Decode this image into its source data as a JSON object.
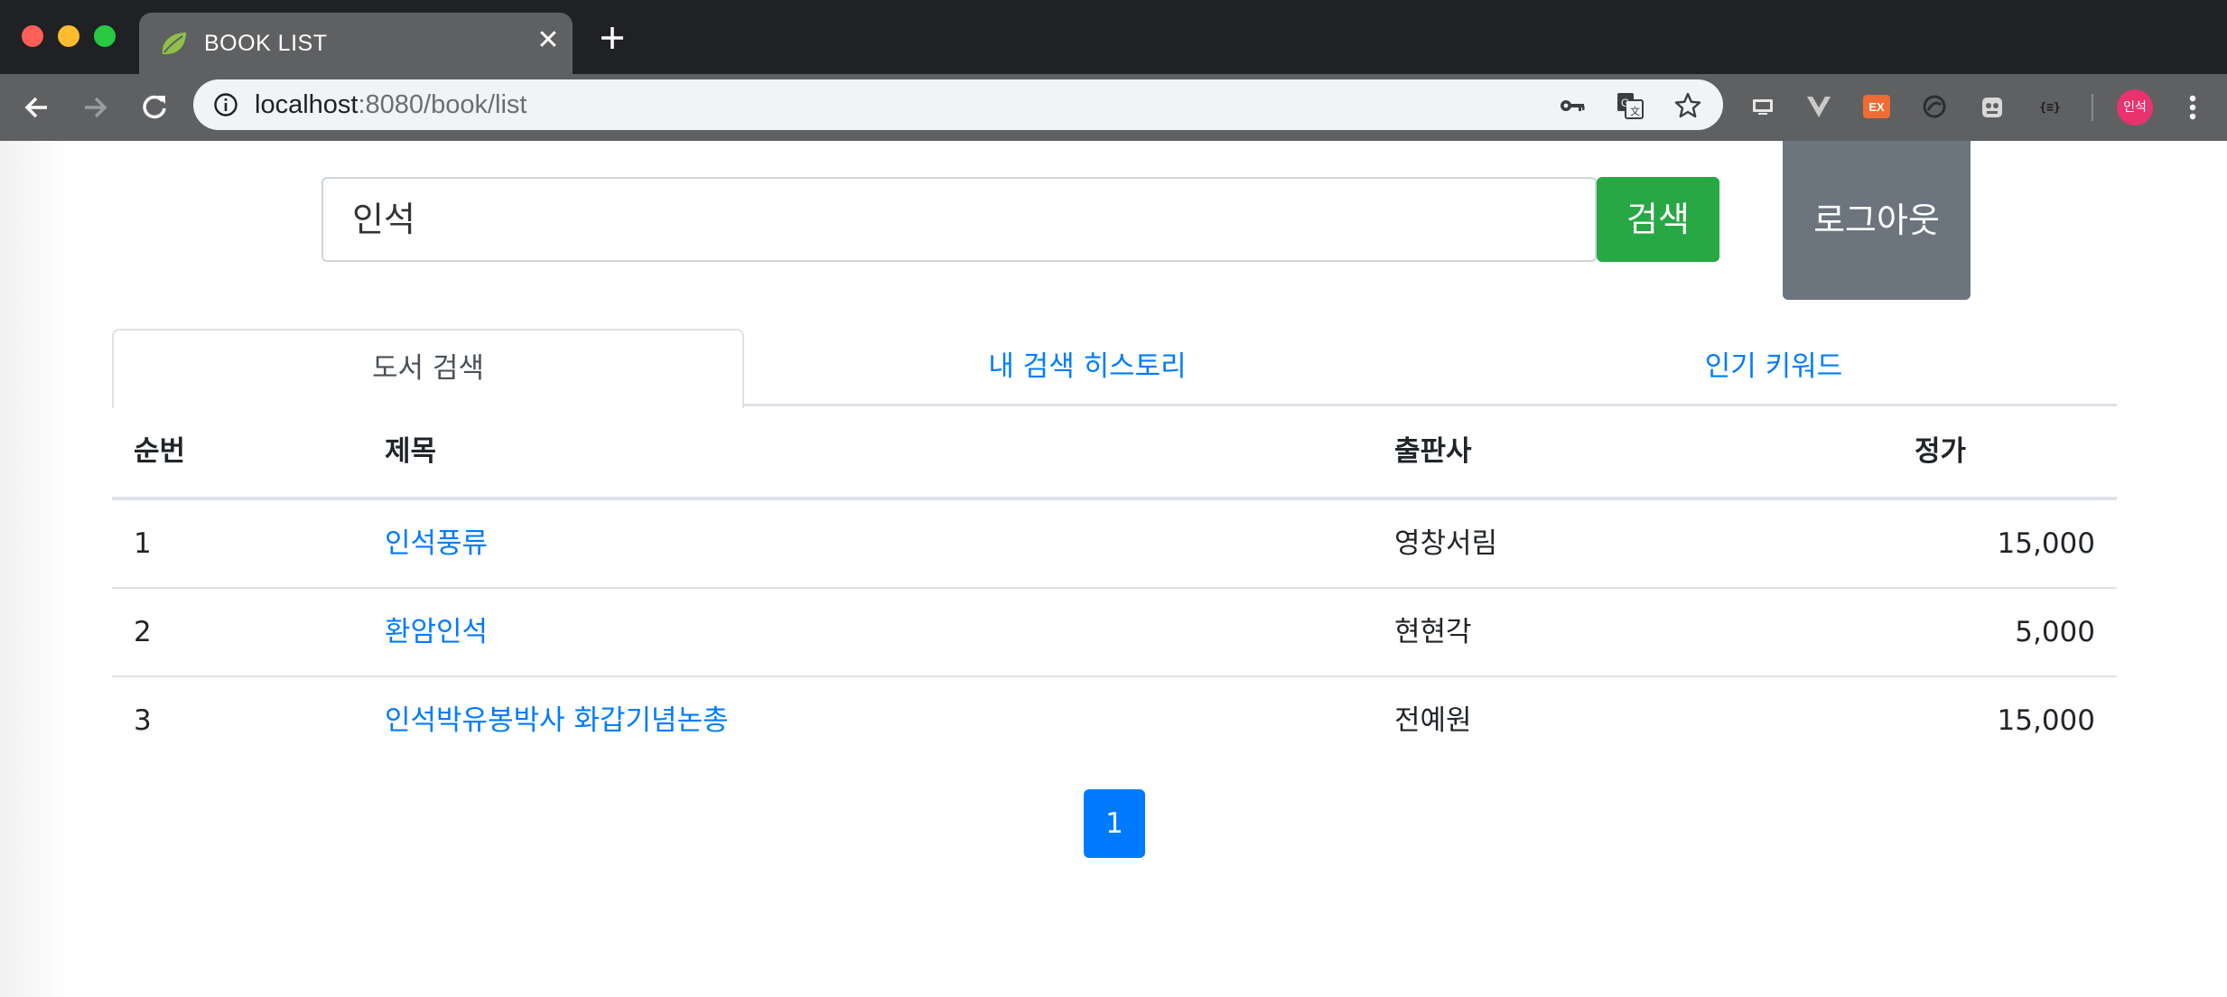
{
  "browser": {
    "tab_title": "BOOK LIST",
    "tab_close": "✕",
    "url_host": "localhost",
    "url_rest": ":8080/book/list",
    "profile_label": "인석"
  },
  "search": {
    "query": "인석",
    "button_label": "검색"
  },
  "logout_label": "로그아웃",
  "tabs": [
    {
      "label": "도서 검색",
      "active": true
    },
    {
      "label": "내 검색 히스토리",
      "active": false
    },
    {
      "label": "인기 키워드",
      "active": false
    }
  ],
  "table": {
    "headers": {
      "num": "순번",
      "title": "제목",
      "publisher": "출판사",
      "price": "정가"
    },
    "rows": [
      {
        "num": "1",
        "title": "인석풍류",
        "publisher": "영창서림",
        "price": "15,000"
      },
      {
        "num": "2",
        "title": "환암인석",
        "publisher": "현현각",
        "price": "5,000"
      },
      {
        "num": "3",
        "title": "인석박유봉박사 화갑기념논총",
        "publisher": "전예원",
        "price": "15,000"
      }
    ]
  },
  "pagination": {
    "current": "1"
  },
  "colors": {
    "primary": "#007bff",
    "success": "#28a745",
    "secondary": "#6c757d"
  },
  "icons": [
    "spring-leaf-favicon",
    "info-icon",
    "key-icon",
    "translate-icon",
    "star-icon",
    "back-arrow-icon",
    "forward-arrow-icon",
    "reload-icon",
    "menu-icon"
  ]
}
